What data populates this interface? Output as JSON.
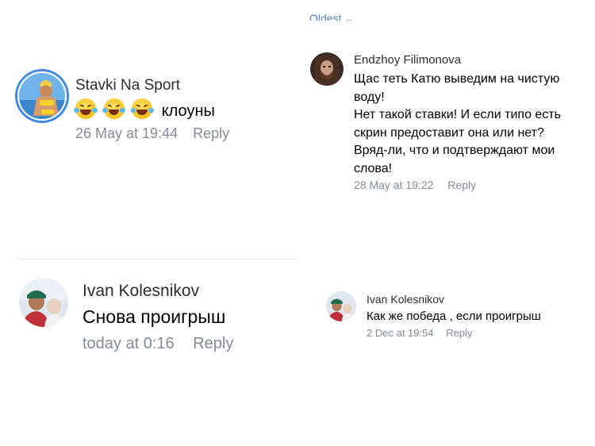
{
  "left_top": {
    "author": "Stavki Na Sport",
    "message": "клоуны",
    "timestamp": "26 May at 19:44",
    "reply_label": "Reply",
    "emoji_icons": [
      "rolling-laughing-icon",
      "rolling-laughing-icon",
      "rolling-laughing-icon"
    ]
  },
  "left_bottom": {
    "author": "Ivan Kolesnikov",
    "message": "Снова проигрыш",
    "timestamp": "today at 0:16",
    "reply_label": "Reply"
  },
  "right_top": {
    "sort_label_partial": "Oldest ⌄",
    "author": "Endzhoy Filimonova",
    "message_lines": [
      "Щас теть Катю выведим на чистую",
      "воду!",
      "Нет такой ставки! И если типо есть",
      "скрин предоставит она или нет?",
      "Вряд-ли, что и подтверждают мои",
      "слова!"
    ],
    "timestamp": "28 May at 19:22",
    "reply_label": "Reply"
  },
  "right_bottom": {
    "author": "Ivan Kolesnikov",
    "message": "Как же победа , если проигрыш",
    "timestamp": "2 Dec at 19:54",
    "reply_label": "Reply"
  },
  "colors": {
    "meta_gray": "#818c99",
    "link_blue": "#5181b8",
    "avatar_ring": "#3f8ae0"
  }
}
